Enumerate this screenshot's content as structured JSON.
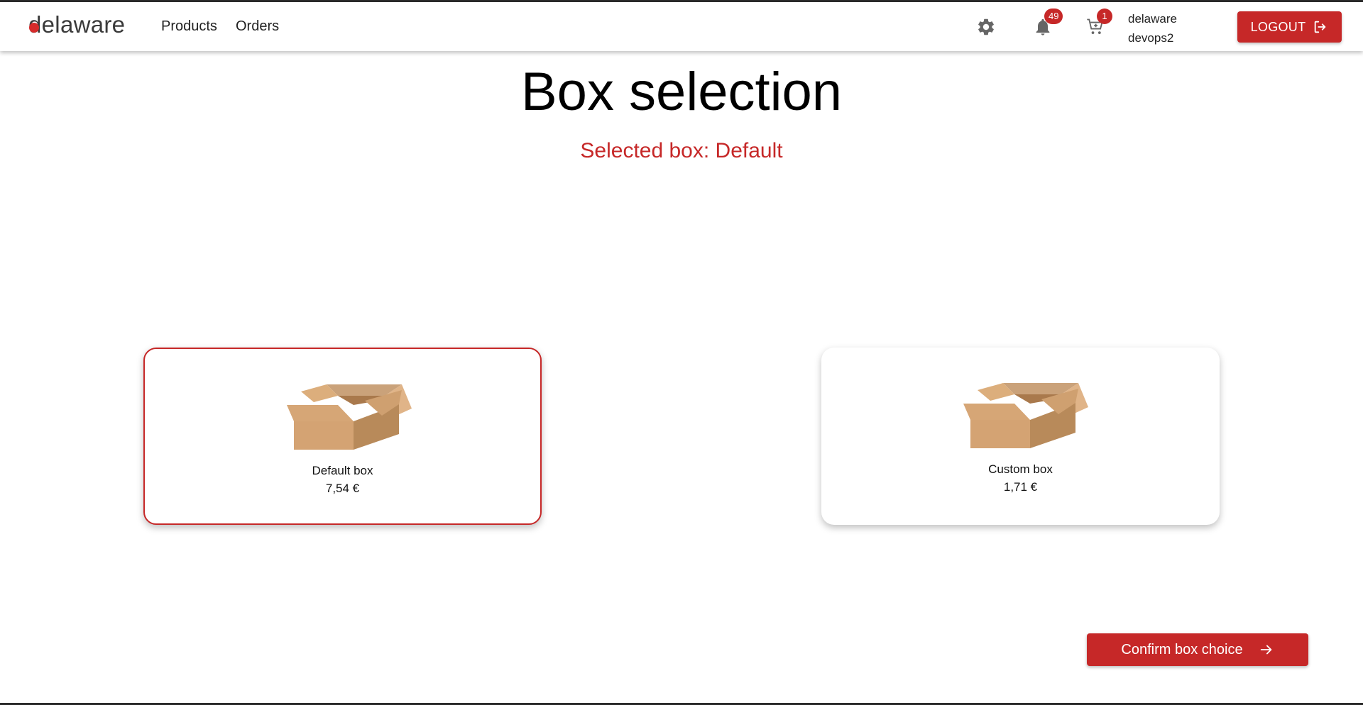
{
  "header": {
    "logo_text": "delaware",
    "nav": [
      {
        "label": "Products"
      },
      {
        "label": "Orders"
      }
    ],
    "settings_icon": "gear-icon",
    "notifications": {
      "icon": "bell-icon",
      "count": "49"
    },
    "cart": {
      "icon": "cart-icon",
      "count": "1"
    },
    "user": {
      "line1": "delaware",
      "line2": "devops2"
    },
    "logout_label": "LOGOUT",
    "logout_icon": "logout-icon"
  },
  "page": {
    "title": "Box selection",
    "selected_text": "Selected box: Default"
  },
  "boxes": [
    {
      "name": "Default box",
      "price": "7,54 €",
      "selected": true,
      "icon": "cardboard-box-icon"
    },
    {
      "name": "Custom box",
      "price": "1,71 €",
      "selected": false,
      "icon": "cardboard-box-icon"
    }
  ],
  "confirm": {
    "label": "Confirm box choice",
    "icon": "arrow-right-icon"
  },
  "colors": {
    "accent": "#c62828",
    "box_light": "#d4a373",
    "box_dark": "#b88a5a"
  }
}
